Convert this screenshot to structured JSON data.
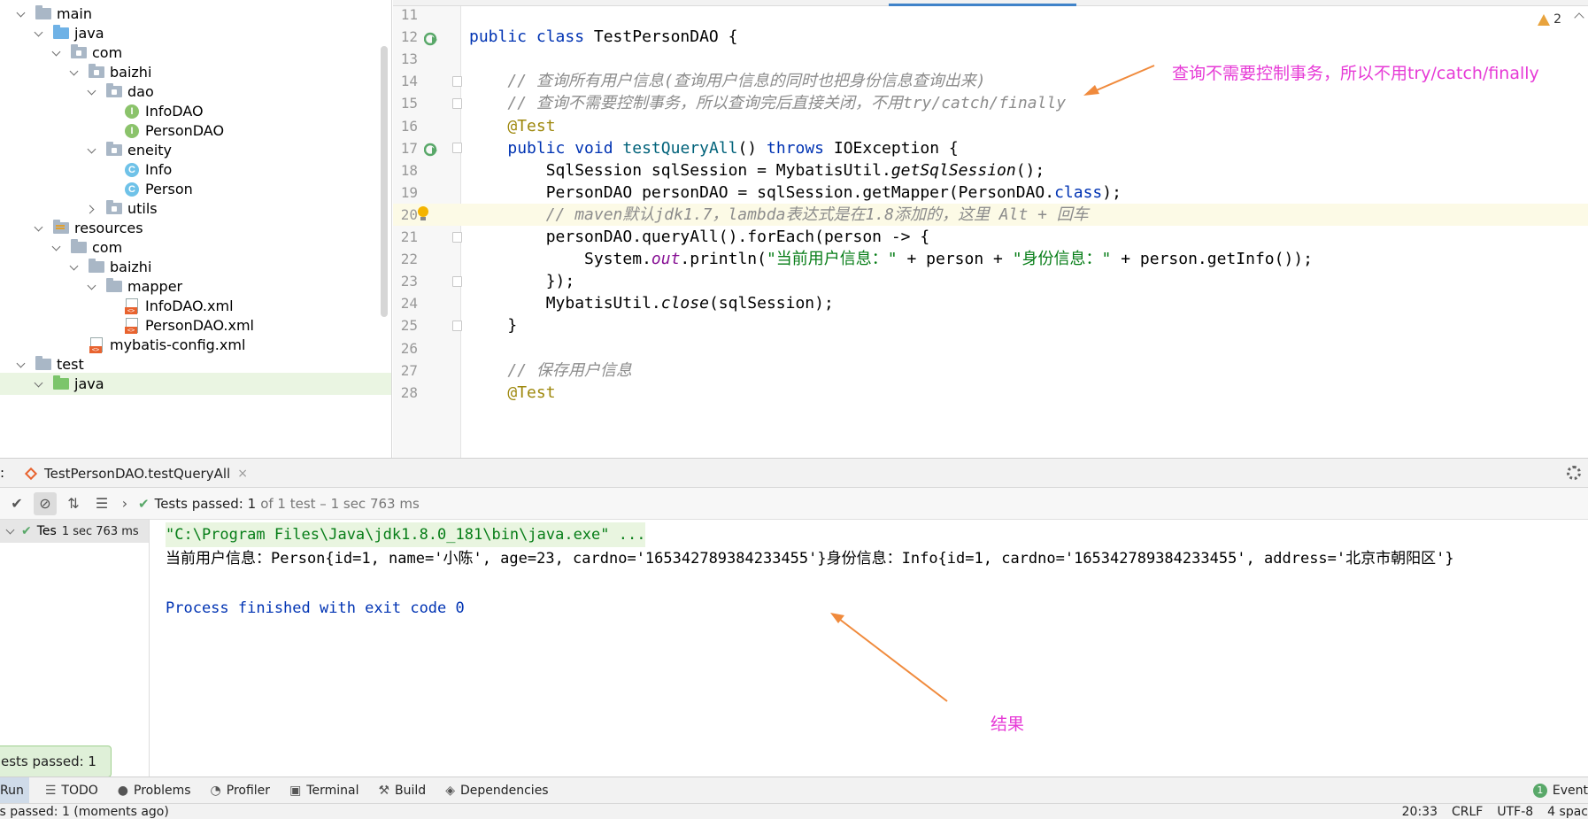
{
  "tree": {
    "items": [
      {
        "label": "main",
        "indent": 0,
        "chev": "open",
        "icon": "folder"
      },
      {
        "label": "java",
        "indent": 1,
        "chev": "open",
        "icon": "folder-blue"
      },
      {
        "label": "com",
        "indent": 2,
        "chev": "open",
        "icon": "package"
      },
      {
        "label": "baizhi",
        "indent": 3,
        "chev": "open",
        "icon": "package"
      },
      {
        "label": "dao",
        "indent": 4,
        "chev": "open",
        "icon": "package"
      },
      {
        "label": "InfoDAO",
        "indent": 5,
        "chev": "none",
        "icon": "interface"
      },
      {
        "label": "PersonDAO",
        "indent": 5,
        "chev": "none",
        "icon": "interface"
      },
      {
        "label": "eneity",
        "indent": 4,
        "chev": "open",
        "icon": "package"
      },
      {
        "label": "Info",
        "indent": 5,
        "chev": "none",
        "icon": "class"
      },
      {
        "label": "Person",
        "indent": 5,
        "chev": "none",
        "icon": "class"
      },
      {
        "label": "utils",
        "indent": 4,
        "chev": "closed",
        "icon": "package"
      },
      {
        "label": "resources",
        "indent": 1,
        "chev": "open",
        "icon": "folder-resources"
      },
      {
        "label": "com",
        "indent": 2,
        "chev": "open",
        "icon": "folder"
      },
      {
        "label": "baizhi",
        "indent": 3,
        "chev": "open",
        "icon": "folder"
      },
      {
        "label": "mapper",
        "indent": 4,
        "chev": "open",
        "icon": "folder"
      },
      {
        "label": "InfoDAO.xml",
        "indent": 5,
        "chev": "none",
        "icon": "xml"
      },
      {
        "label": "PersonDAO.xml",
        "indent": 5,
        "chev": "none",
        "icon": "xml"
      },
      {
        "label": "mybatis-config.xml",
        "indent": 3,
        "chev": "none",
        "icon": "xml"
      },
      {
        "label": "test",
        "indent": 0,
        "chev": "open",
        "icon": "folder"
      },
      {
        "label": "java",
        "indent": 1,
        "chev": "open",
        "icon": "folder-green",
        "selected": true
      }
    ]
  },
  "editor": {
    "warnings_count": "2",
    "lines": [
      {
        "n": "11",
        "html": ""
      },
      {
        "n": "12",
        "html": "<span class=\"kw\">public class</span> TestPersonDAO {",
        "run": true
      },
      {
        "n": "13",
        "html": ""
      },
      {
        "n": "14",
        "html": "    <span class=\"cm\">// 查询所有用户信息(查询用户信息的同时也把身份信息查询出来)</span>",
        "fold": true
      },
      {
        "n": "15",
        "html": "    <span class=\"cm\">// 查询不需要控制事务，所以查询完后直接关闭，不用try/catch/finally</span>",
        "fold": true
      },
      {
        "n": "16",
        "html": "    <span class=\"an\">@Test</span>"
      },
      {
        "n": "17",
        "html": "    <span class=\"kw\">public void</span> <span class=\"fn\">testQueryAll</span>() <span class=\"kw\">throws</span> IOException {",
        "run": true,
        "fold": true
      },
      {
        "n": "18",
        "html": "        SqlSession sqlSession = MybatisUtil.<span class=\"it\">getSqlSession</span>();"
      },
      {
        "n": "19",
        "html": "        PersonDAO personDAO = sqlSession.getMapper(PersonDAO.<span class=\"kw\">class</span>);"
      },
      {
        "n": "20",
        "html": "        <span class=\"cm\">// maven默认jdk1.7，lambda表达式是在1.8添加的，这里 Alt + 回车</span>",
        "highlight": true,
        "bulb": true
      },
      {
        "n": "21",
        "html": "        personDAO.queryAll().forEach(person -> {",
        "fold": true
      },
      {
        "n": "22",
        "html": "            System.<span class=\"fld\">out</span>.println(<span class=\"st\">\"当前用户信息：\"</span> + person + <span class=\"st\">\"身份信息：\"</span> + person.getInfo());"
      },
      {
        "n": "23",
        "html": "        });",
        "fold": true
      },
      {
        "n": "24",
        "html": "        MybatisUtil.<span class=\"it\">close</span>(sqlSession);"
      },
      {
        "n": "25",
        "html": "    }",
        "fold": true
      },
      {
        "n": "26",
        "html": ""
      },
      {
        "n": "27",
        "html": "    <span class=\"cm\">// 保存用户信息</span>"
      },
      {
        "n": "28",
        "html": "    <span class=\"an\">@Test</span>"
      }
    ]
  },
  "annotations": {
    "top": "查询不需要控制事务，所以不用try/catch/finally",
    "bottom": "结果",
    "color": "#e63ad6",
    "arrow_color": "#f08a3c"
  },
  "run": {
    "prefix": ":",
    "tab_label": "TestPersonDAO.testQueryAll",
    "tab_close": "×",
    "status_main": "Tests passed:",
    "status_count": "1",
    "status_detail": "of 1 test – 1 sec 763 ms",
    "test_row_label": "Tes",
    "test_row_time": "1 sec 763 ms",
    "console": {
      "cmd": "\"C:\\Program Files\\Java\\jdk1.8.0_181\\bin\\java.exe\" ...",
      "output": "当前用户信息：Person{id=1, name='小陈', age=23, cardno='165342789384233455'}身份信息：Info{id=1, cardno='165342789384233455', address='北京市朝阳区'}",
      "exit": "Process finished with exit code 0"
    },
    "toast": "ests passed: 1"
  },
  "toolwindows": {
    "run": "Run",
    "todo": "TODO",
    "problems": "Problems",
    "profiler": "Profiler",
    "terminal": "Terminal",
    "build": "Build",
    "dependencies": "Dependencies",
    "event_log": "Event",
    "event_count": "1"
  },
  "statusbar": {
    "left": "ts passed: 1 (moments ago)",
    "position": "20:33",
    "line_sep": "CRLF",
    "encoding": "UTF-8",
    "indent": "4 spac"
  }
}
